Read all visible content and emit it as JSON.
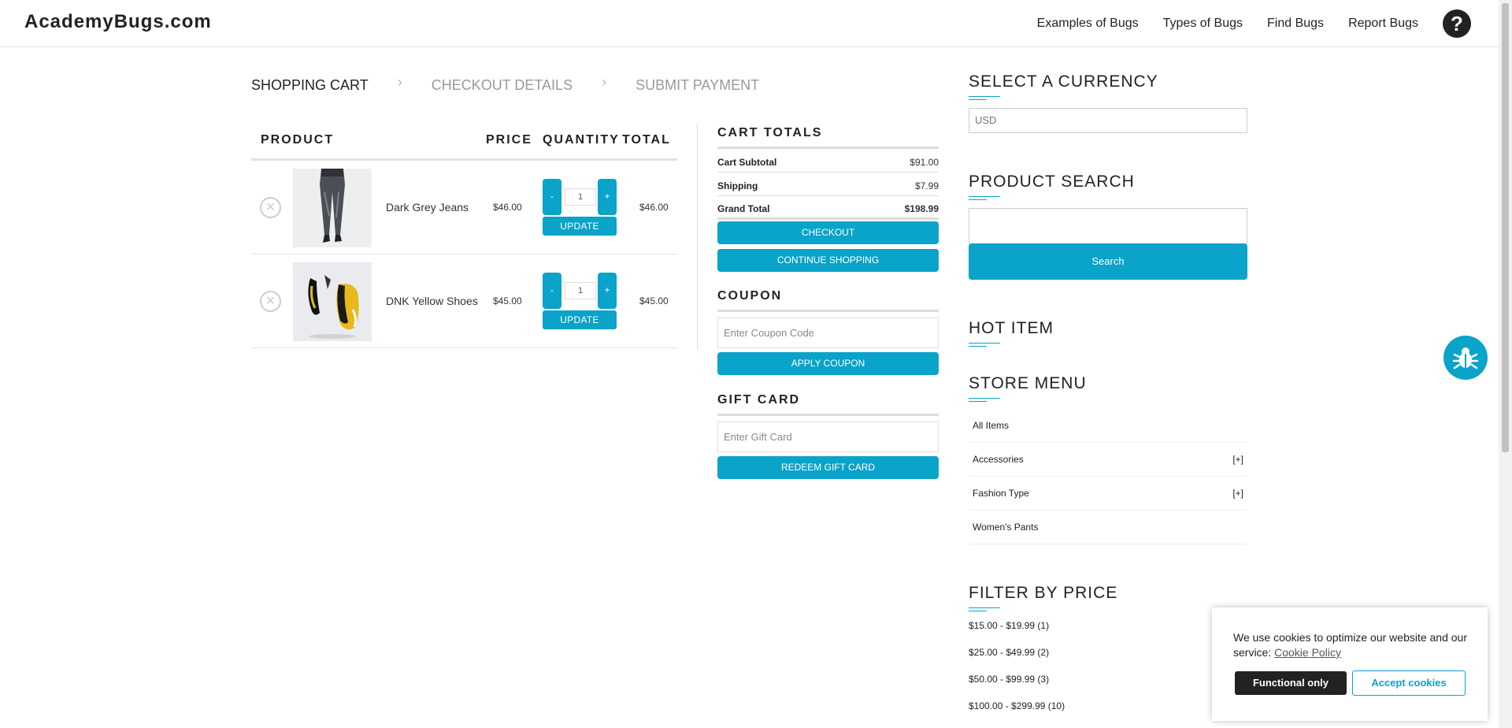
{
  "header": {
    "logo": "AcademyBugs.com",
    "nav": [
      "Examples of Bugs",
      "Types of Bugs",
      "Find Bugs",
      "Report Bugs"
    ],
    "help_icon": "question-icon"
  },
  "breadcrumb": [
    "SHOPPING CART",
    "CHECKOUT DETAILS",
    "SUBMIT PAYMENT"
  ],
  "cart": {
    "headers": {
      "product": "PRODUCT",
      "price": "PRICE",
      "quantity": "QUANTITY",
      "total": "TOTAL"
    },
    "items": [
      {
        "name": "Dark Grey Jeans",
        "price": "$46.00",
        "qty": "1",
        "total": "$46.00",
        "minus": "-",
        "plus": "+",
        "update": "UPDATE"
      },
      {
        "name": "DNK Yellow Shoes",
        "price": "$45.00",
        "qty": "1",
        "total": "$45.00",
        "minus": "-",
        "plus": "+",
        "update": "UPDATE"
      }
    ]
  },
  "totals": {
    "title": "CART TOTALS",
    "rows": [
      {
        "label": "Cart Subtotal",
        "value": "$91.00"
      },
      {
        "label": "Shipping",
        "value": "$7.99"
      },
      {
        "label": "Grand Total",
        "value": "$198.99"
      }
    ],
    "checkout": "CHECKOUT",
    "continue": "CONTINUE SHOPPING"
  },
  "coupon": {
    "title": "COUPON",
    "placeholder": "Enter Coupon Code",
    "button": "APPLY COUPON"
  },
  "giftcard": {
    "title": "GIFT CARD",
    "placeholder": "Enter Gift Card",
    "button": "REDEEM GIFT CARD"
  },
  "sidebar": {
    "currency_title": "SELECT A CURRENCY",
    "currency_value": "USD",
    "search_title": "PRODUCT SEARCH",
    "search_button": "Search",
    "hot_title": "HOT ITEM",
    "menu_title": "STORE MENU",
    "menu": [
      {
        "label": "All Items",
        "expand": ""
      },
      {
        "label": "Accessories",
        "expand": "[+]"
      },
      {
        "label": "Fashion Type",
        "expand": "[+]"
      },
      {
        "label": "Women's Pants",
        "expand": ""
      }
    ],
    "filter_title": "FILTER BY PRICE",
    "filters": [
      "$15.00 - $19.99 (1)",
      "$25.00 - $49.99 (2)",
      "$50.00 - $99.99 (3)",
      "$100.00 - $299.99 (10)"
    ]
  },
  "cookie": {
    "text": "We use cookies to optimize our website and our service:",
    "link": "Cookie Policy",
    "functional": "Functional only",
    "accept": "Accept cookies"
  },
  "colors": {
    "accent": "#0aa3c9",
    "dark": "#222222"
  }
}
